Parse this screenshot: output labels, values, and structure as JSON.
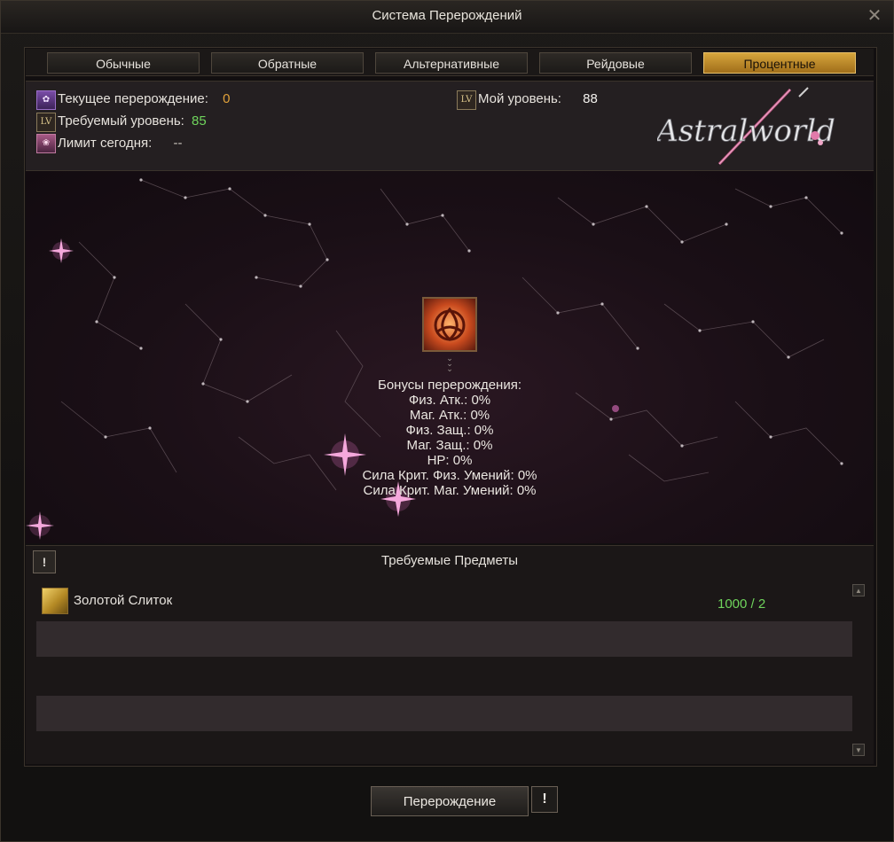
{
  "window": {
    "title": "Система Перерождений"
  },
  "tabs": [
    {
      "label": "Обычные",
      "active": false
    },
    {
      "label": "Обратные",
      "active": false
    },
    {
      "label": "Альтернативные",
      "active": false
    },
    {
      "label": "Рейдовые",
      "active": false
    },
    {
      "label": "Процентные",
      "active": true
    }
  ],
  "info": {
    "current_reborn_label": "Текущее перерождение:",
    "current_reborn_value": "0",
    "required_level_label": "Требуемый уровень:",
    "required_level_value": "85",
    "daily_limit_label": "Лимит сегодня:",
    "daily_limit_value": "--",
    "my_level_label": "Мой уровень:",
    "my_level_value": "88",
    "level_icon_text": "LV"
  },
  "logo": {
    "text": "Astralworld"
  },
  "bonuses": {
    "title": "Бонусы перерождения:",
    "lines": [
      "Физ. Атк.: 0%",
      "Маг. Атк.: 0%",
      "Физ. Защ.: 0%",
      "Маг. Защ.: 0%",
      "HP: 0%",
      "Сила Крит. Физ. Умений: 0%",
      "Сила Крит. Маг. Умений: 0%"
    ]
  },
  "required_items": {
    "title": "Требуемые Предметы",
    "warn_symbol": "!",
    "items": [
      {
        "name": "Золотой Слиток",
        "count": "1000 / 2",
        "icon": "gold-bar-icon"
      }
    ]
  },
  "actions": {
    "reborn_label": "Перерождение",
    "warn_symbol": "!"
  },
  "colors": {
    "accent_gold": "#d6a53c",
    "value_orange": "#e2a23a",
    "value_green": "#6fd45c",
    "sky_pink": "#e070c0"
  }
}
